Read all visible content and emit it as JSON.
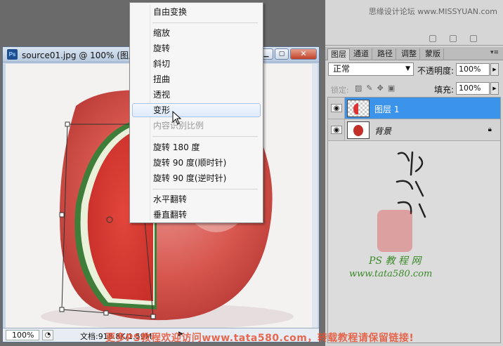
{
  "document": {
    "title": "source01.jpg @ 100% (图层",
    "zoom": "100%",
    "status_text": "文档:918.8K/1.59M",
    "buttons": {
      "minimize": "▁",
      "restore": "▢",
      "close": "✕"
    }
  },
  "context_menu": {
    "items": [
      {
        "label": "自由变换",
        "state": "normal"
      },
      {
        "label": "缩放",
        "state": "normal"
      },
      {
        "label": "旋转",
        "state": "normal"
      },
      {
        "label": "斜切",
        "state": "normal"
      },
      {
        "label": "扭曲",
        "state": "normal"
      },
      {
        "label": "透视",
        "state": "normal"
      },
      {
        "label": "变形",
        "state": "hover"
      },
      {
        "label": "内容识别比例",
        "state": "disabled"
      },
      {
        "label": "旋转 180 度",
        "state": "normal"
      },
      {
        "label": "旋转 90 度(顺时针)",
        "state": "normal"
      },
      {
        "label": "旋转 90 度(逆时针)",
        "state": "normal"
      },
      {
        "label": "水平翻转",
        "state": "normal"
      },
      {
        "label": "垂直翻转",
        "state": "normal"
      }
    ]
  },
  "upper_panel": {
    "watermark": "思缘设计论坛 www.MISSYUAN.com"
  },
  "layers_panel": {
    "tabs": [
      "图层",
      "通道",
      "路径",
      "调整",
      "蒙版"
    ],
    "active_tab": "图层",
    "blend_mode": "正常",
    "opacity_label": "不透明度:",
    "opacity_value": "100%",
    "lock_label": "锁定:",
    "fill_label": "填充:",
    "fill_value": "100%",
    "layers": [
      {
        "name": "图层 1",
        "selected": true
      },
      {
        "name": "背景",
        "selected": false,
        "locked": true
      }
    ]
  },
  "branding": {
    "ps_tutorial": "PS 教 程 网",
    "site_url": "www.tata580.com",
    "bottom_watermark": "更多PS教程欢迎访问www.tata580.com，转载教程请保留链接!"
  },
  "colors": {
    "selected_layer": "#3c93ea",
    "watermark_red": "#e65032",
    "brand_green": "#3b8a2a"
  }
}
